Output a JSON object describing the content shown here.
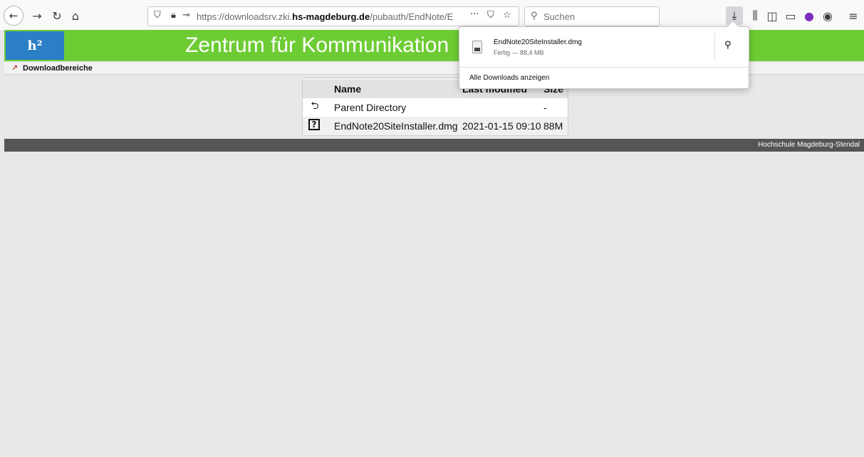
{
  "browser": {
    "url_prefix": "https://downloadsrv.zki.",
    "url_domain": "hs-magdeburg.de",
    "url_path": "/pubauth/EndNote/EndN",
    "search_placeholder": "Suchen",
    "icons": [
      "back-arrow-icon",
      "forward-arrow-icon",
      "reload-icon",
      "home-icon",
      "shield-icon",
      "lock-icon",
      "key-icon",
      "more-icon",
      "pocket-icon",
      "star-icon",
      "search-icon",
      "download-icon",
      "library-icon",
      "sidebar-icon",
      "reader-icon",
      "extension-icon",
      "account-icon",
      "menu-icon"
    ]
  },
  "site": {
    "logo_text": "h²",
    "title": "Zentrum für Kommunikation",
    "breadcrumb_link": "Downloadbereiche",
    "footer_text": "Hochschule Magdeburg-Stendal"
  },
  "listing": {
    "headers": {
      "name": "Name",
      "modified": "Last modified",
      "size": "Size"
    },
    "rows": [
      {
        "icon": "back-icon",
        "name": "Parent Directory",
        "modified": "",
        "size": "-"
      },
      {
        "icon": "unknown-file-icon",
        "name": "EndNote20SiteInstaller.dmg",
        "modified": "2021-01-15 09:10",
        "size": "88M"
      }
    ]
  },
  "downloads_panel": {
    "file_name": "EndNote20SiteInstaller.dmg",
    "status": "Fertig — 88,4 MB",
    "show_all": "Alle Downloads anzeigen"
  }
}
